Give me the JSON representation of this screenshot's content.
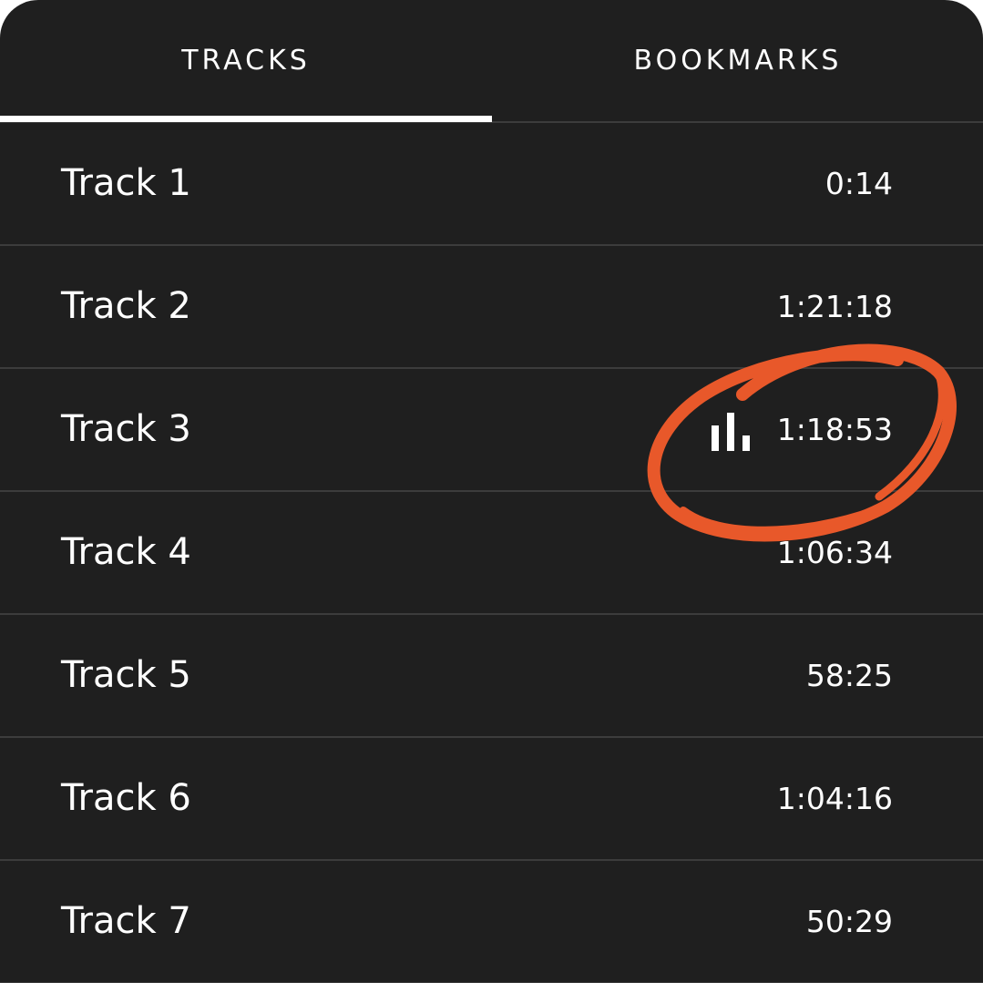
{
  "tabs": {
    "tracks_label": "TRACKS",
    "bookmarks_label": "BOOKMARKS",
    "active": "tracks"
  },
  "tracks": [
    {
      "title": "Track 1",
      "duration": "0:14"
    },
    {
      "title": "Track 2",
      "duration": "1:21:18"
    },
    {
      "title": "Track 3",
      "duration": "1:18:53",
      "playing": true
    },
    {
      "title": "Track 4",
      "duration": "1:06:34"
    },
    {
      "title": "Track 5",
      "duration": "58:25"
    },
    {
      "title": "Track 6",
      "duration": "1:04:16"
    },
    {
      "title": "Track 7",
      "duration": "50:29"
    }
  ],
  "icons": {
    "now_playing": "equalizer-bars-icon"
  },
  "colors": {
    "background": "#1f1f1f",
    "divider": "#3c3c3c",
    "text": "#ffffff",
    "annotation": "#e8582a"
  }
}
